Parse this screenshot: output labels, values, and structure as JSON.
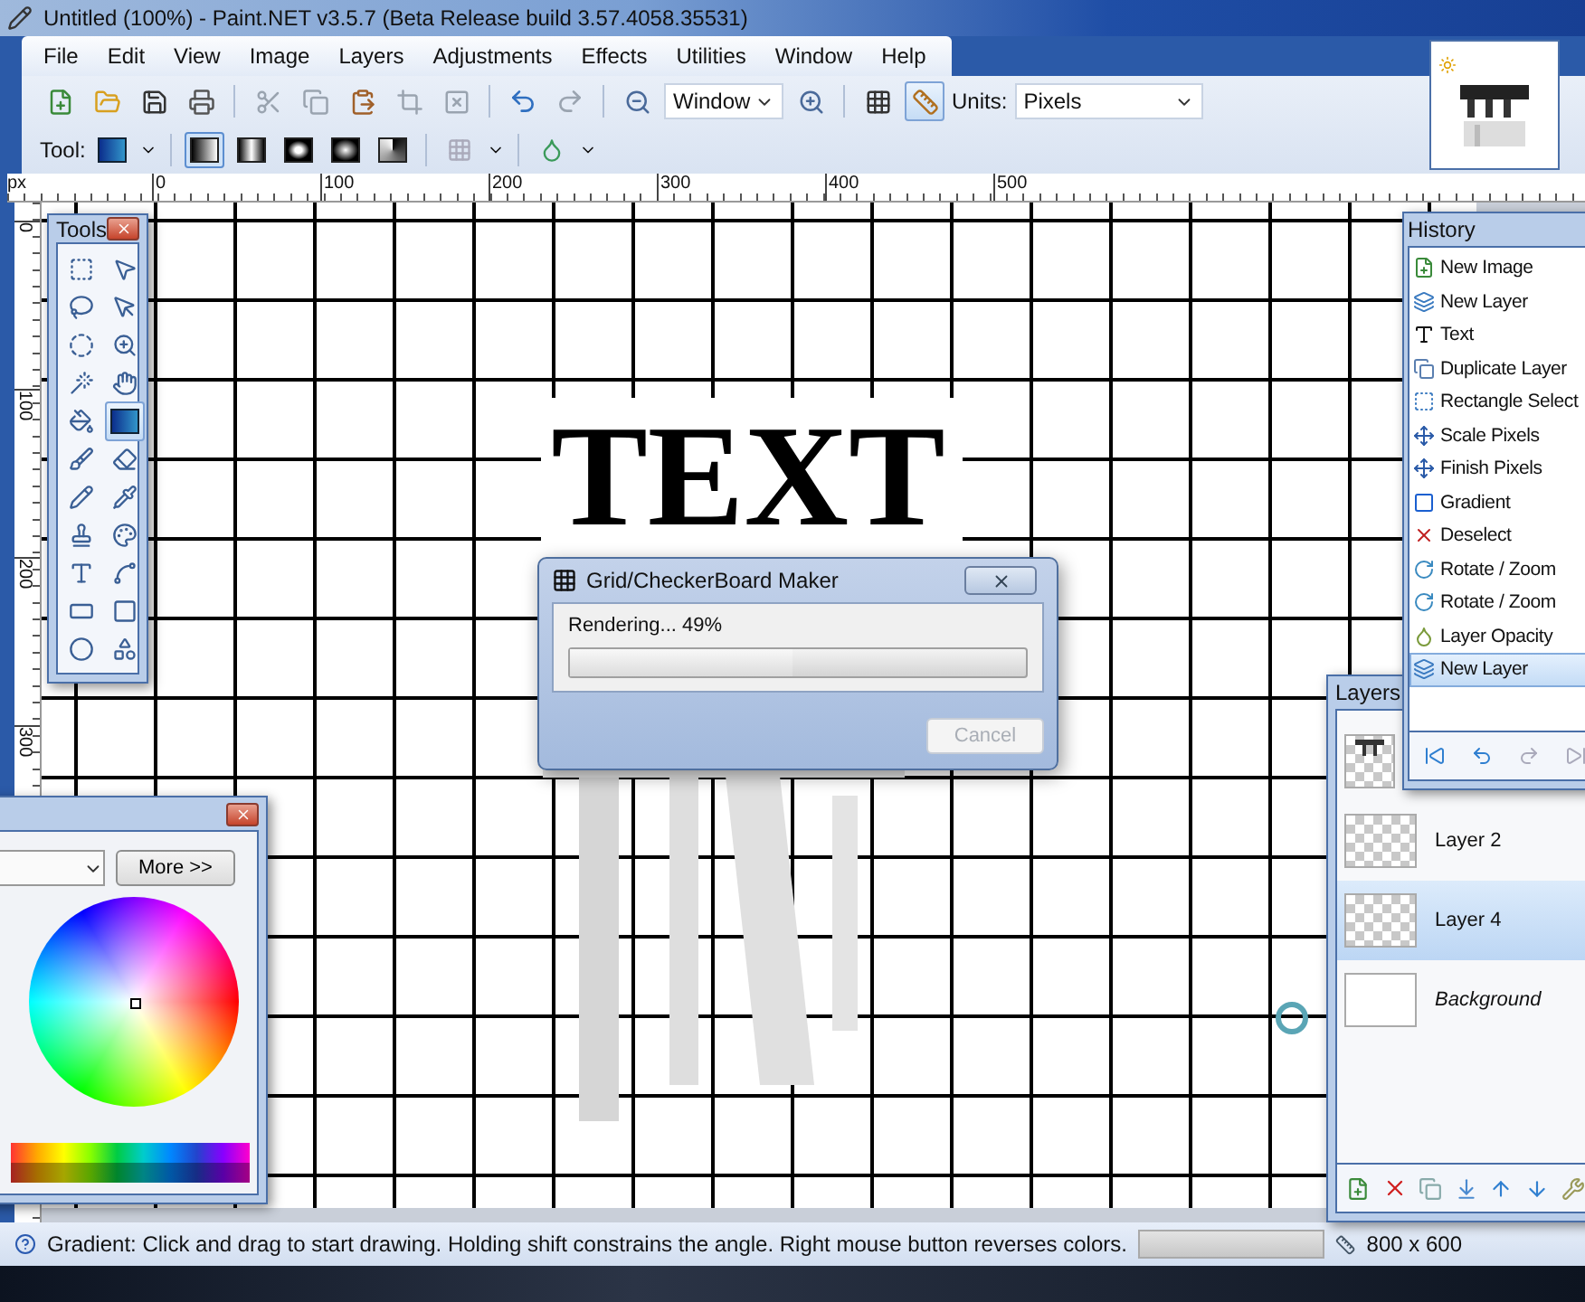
{
  "window": {
    "title": "Untitled (100%) - Paint.NET v3.5.7 (Beta Release build 3.57.4058.35531)"
  },
  "menu": [
    "File",
    "Edit",
    "View",
    "Image",
    "Layers",
    "Adjustments",
    "Effects",
    "Utilities",
    "Window",
    "Help"
  ],
  "toolbar": {
    "zoom": "Window",
    "units_label": "Units:",
    "units": "Pixels",
    "grid_on": false,
    "rulers_on": true,
    "tool_label": "Tool:",
    "gradient_modes": [
      {
        "kind": "linear",
        "selected": true
      },
      {
        "kind": "reflected",
        "selected": false
      },
      {
        "kind": "diamond",
        "selected": false
      },
      {
        "kind": "radial",
        "selected": false
      },
      {
        "kind": "conical",
        "selected": false
      }
    ]
  },
  "ruler": {
    "unit": "px",
    "x_labels": [
      "0",
      "100",
      "200",
      "300",
      "400",
      "500"
    ],
    "y_labels": [
      "0",
      "100",
      "200",
      "300"
    ]
  },
  "canvas": {
    "text": "TEXT"
  },
  "tools_window": {
    "title": "Tools",
    "tools": [
      {
        "kind": "rect-select",
        "selected": false
      },
      {
        "kind": "move-pixels",
        "selected": false
      },
      {
        "kind": "lasso",
        "selected": false
      },
      {
        "kind": "move-selection",
        "selected": false
      },
      {
        "kind": "ellipse-select",
        "selected": false
      },
      {
        "kind": "zoom",
        "selected": false
      },
      {
        "kind": "magic-wand",
        "selected": false
      },
      {
        "kind": "pan",
        "selected": false
      },
      {
        "kind": "bucket",
        "selected": false
      },
      {
        "kind": "gradient",
        "selected": true
      },
      {
        "kind": "brush",
        "selected": false
      },
      {
        "kind": "eraser",
        "selected": false
      },
      {
        "kind": "pencil",
        "selected": false
      },
      {
        "kind": "picker",
        "selected": false
      },
      {
        "kind": "stamp",
        "selected": false
      },
      {
        "kind": "recolor",
        "selected": false
      },
      {
        "kind": "text",
        "selected": false
      },
      {
        "kind": "line",
        "selected": false
      },
      {
        "kind": "rectangle",
        "selected": false
      },
      {
        "kind": "rounded",
        "selected": false
      },
      {
        "kind": "ellipse",
        "selected": false
      },
      {
        "kind": "freeform",
        "selected": false
      }
    ]
  },
  "history_window": {
    "title": "History",
    "items": [
      {
        "label": "New Image",
        "kind": "new-image",
        "selected": false
      },
      {
        "label": "New Layer",
        "kind": "new-layer",
        "selected": false
      },
      {
        "label": "Text",
        "kind": "text",
        "selected": false
      },
      {
        "label": "Duplicate Layer",
        "kind": "duplicate",
        "selected": false
      },
      {
        "label": "Rectangle Select",
        "kind": "select",
        "selected": false
      },
      {
        "label": "Scale Pixels",
        "kind": "move",
        "selected": false
      },
      {
        "label": "Finish Pixels",
        "kind": "move",
        "selected": false
      },
      {
        "label": "Gradient",
        "kind": "gradient",
        "selected": false
      },
      {
        "label": "Deselect",
        "kind": "deselect",
        "selected": false
      },
      {
        "label": "Rotate / Zoom",
        "kind": "rotate",
        "selected": false
      },
      {
        "label": "Rotate / Zoom",
        "kind": "rotate",
        "selected": false
      },
      {
        "label": "Layer Opacity",
        "kind": "opacity",
        "selected": false
      },
      {
        "label": "New Layer",
        "kind": "new-layer",
        "selected": true
      }
    ]
  },
  "layers_window": {
    "title": "Layers",
    "layers": [
      {
        "kind": "text",
        "selected": false
      },
      {
        "name": "Layer 2",
        "kind": "layer",
        "selected": false
      },
      {
        "name": "Layer 4",
        "kind": "layer",
        "selected": true
      },
      {
        "name": "Background",
        "kind": "background",
        "selected": false
      }
    ]
  },
  "colors_window": {
    "more_button": "More >>"
  },
  "dialog": {
    "title": "Grid/CheckerBoard Maker",
    "message": "Rendering... 49%",
    "level": 0.49,
    "cancel": "Cancel",
    "cancel_disabled": true
  },
  "status_bar": {
    "message": "Gradient: Click and drag to start drawing. Holding shift constrains the angle. Right mouse button reverses colors.",
    "size": "800 x 600",
    "level": 0
  }
}
